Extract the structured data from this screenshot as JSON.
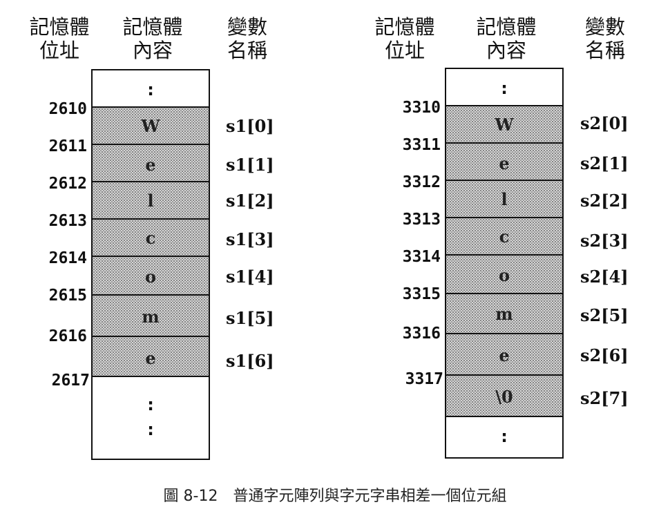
{
  "headers": {
    "address": [
      "記憶體",
      "位址"
    ],
    "content": [
      "記憶體",
      "內容"
    ],
    "variable": [
      "變數",
      "名稱"
    ]
  },
  "left": {
    "addresses": [
      "2610",
      "2611",
      "2612",
      "2613",
      "2614",
      "2615",
      "2616",
      "2617"
    ],
    "chars": [
      "W",
      "e",
      "l",
      "c",
      "o",
      "m",
      "e"
    ],
    "names": [
      "s1[0]",
      "s1[1]",
      "s1[2]",
      "s1[3]",
      "s1[4]",
      "s1[5]",
      "s1[6]"
    ],
    "ellipsis": ":"
  },
  "right": {
    "addresses": [
      "3310",
      "3311",
      "3312",
      "3313",
      "3314",
      "3315",
      "3316",
      "3317"
    ],
    "chars": [
      "W",
      "e",
      "l",
      "c",
      "o",
      "m",
      "e",
      "\\0"
    ],
    "names": [
      "s2[0]",
      "s2[1]",
      "s2[2]",
      "s2[3]",
      "s2[4]",
      "s2[5]",
      "s2[6]",
      "s2[7]"
    ],
    "ellipsis": ":"
  },
  "caption": "圖 8-12　普通字元陣列與字元字串相差一個位元組"
}
